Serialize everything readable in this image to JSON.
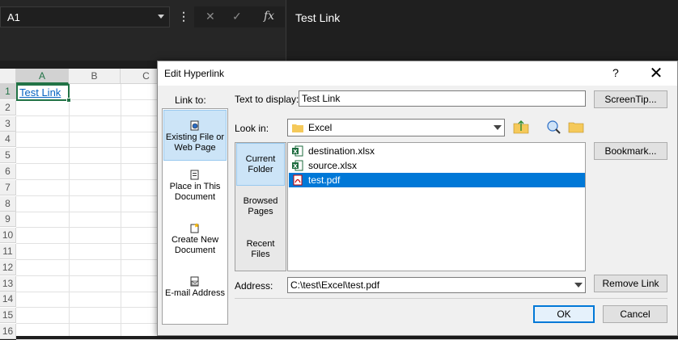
{
  "excel": {
    "name_box": "A1",
    "formula_value": "Test Link",
    "columns": [
      "A",
      "B",
      "C"
    ],
    "rows": [
      "1",
      "2",
      "3",
      "4",
      "5",
      "6",
      "7",
      "8",
      "9",
      "10",
      "11",
      "12",
      "13",
      "14",
      "15",
      "16"
    ],
    "cell_a1": "Test Link",
    "fx_symbol": "fx",
    "cancel_symbol": "✕",
    "enter_symbol": "✓"
  },
  "dialog": {
    "title": "Edit Hyperlink",
    "help": "?",
    "close": "✕",
    "link_to_label": "Link to:",
    "link_to_items": [
      {
        "label": "Existing File or Web Page",
        "icon": "globe-file-icon",
        "selected": true
      },
      {
        "label": "Place in This Document",
        "icon": "document-place-icon",
        "selected": false
      },
      {
        "label": "Create New Document",
        "icon": "new-document-icon",
        "selected": false
      },
      {
        "label": "E-mail Address",
        "icon": "email-icon",
        "selected": false
      }
    ],
    "text_to_display_label": "Text to display:",
    "text_to_display_value": "Test Link",
    "screentip_button": "ScreenTip...",
    "look_in_label": "Look in:",
    "look_in_value": "Excel",
    "browse_items": [
      {
        "label": "Current Folder",
        "selected": true
      },
      {
        "label": "Browsed Pages",
        "selected": false
      },
      {
        "label": "Recent Files",
        "selected": false
      }
    ],
    "files": [
      {
        "name": "destination.xlsx",
        "type": "excel",
        "selected": false
      },
      {
        "name": "source.xlsx",
        "type": "excel",
        "selected": false
      },
      {
        "name": "test.pdf",
        "type": "pdf",
        "selected": true
      }
    ],
    "bookmark_button": "Bookmark...",
    "address_label": "Address:",
    "address_value": "C:\\test\\Excel\\test.pdf",
    "remove_link_button": "Remove Link",
    "ok_button": "OK",
    "cancel_button": "Cancel"
  },
  "colors": {
    "excel_green": "#217346",
    "selection_blue": "#0078d7",
    "link_blue": "#0563c1"
  }
}
